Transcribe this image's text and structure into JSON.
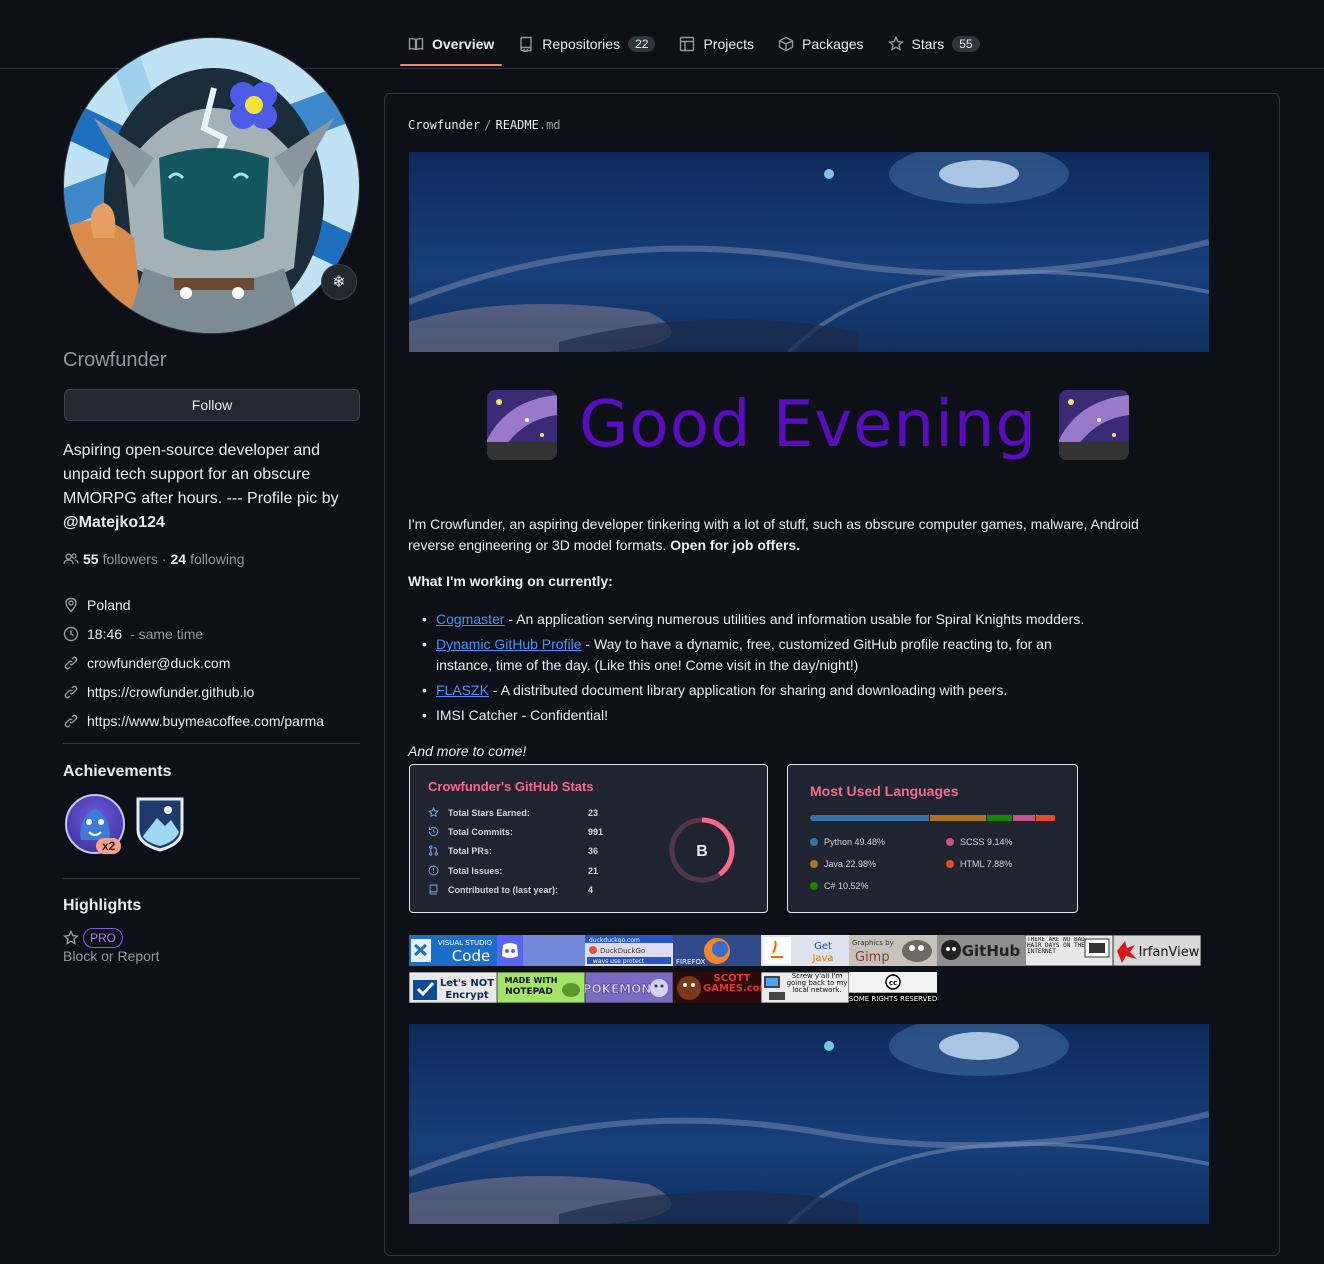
{
  "nav": {
    "tabs": [
      {
        "label": "Overview",
        "icon": "book-icon"
      },
      {
        "label": "Repositories",
        "count": "22",
        "icon": "repo-icon"
      },
      {
        "label": "Projects",
        "icon": "table-icon"
      },
      {
        "label": "Packages",
        "icon": "package-icon"
      },
      {
        "label": "Stars",
        "count": "55",
        "icon": "star-icon"
      }
    ]
  },
  "profile": {
    "status_emoji": "❄",
    "username": "Crowfunder",
    "follow_label": "Follow",
    "bio_text": "Aspiring open-source developer and unpaid tech support for an obscure MMORPG after hours. --- Profile pic by ",
    "bio_mention": "@Matejko124",
    "followers_count": "55",
    "followers_label": "followers",
    "following_sep": "·",
    "following_count": "24",
    "following_label": "following",
    "location": "Poland",
    "local_time": "18:46",
    "time_note": "- same time",
    "email": "crowfunder@duck.com",
    "website": "https://crowfunder.github.io",
    "link2": "https://www.buymeacoffee.com/parma"
  },
  "achievements": {
    "title": "Achievements",
    "multiplier": "x2"
  },
  "highlights": {
    "title": "Highlights",
    "pro_label": "PRO",
    "block_label": "Block or Report"
  },
  "readme": {
    "repo": "Crowfunder",
    "sep": "/",
    "file": "README",
    "ext": ".md",
    "greeting": "Good Evening",
    "intro_text": "I'm Crowfunder, an aspiring developer tinkering with a lot of stuff, such as obscure computer games, malware, Android reverse engineering or 3D model formats. ",
    "intro_bold": "Open for job offers.",
    "working_title": "What I'm working on currently:",
    "projects": [
      {
        "link": "Cogmaster",
        "text": " - An application serving numerous utilities and information usable for Spiral Knights modders."
      },
      {
        "link": "Dynamic GitHub Profile",
        "text": " - Way to have a dynamic, free, customized GitHub profile reacting to, for an instance, time of the day. (Like this one! Come visit in the day/night!)"
      },
      {
        "link": "FLASZK",
        "text": " - A distributed document library application for sharing and downloading with peers."
      },
      {
        "link": "",
        "text": "IMSI Catcher - Confidential!"
      }
    ],
    "more": "And more to come!"
  },
  "github_stats": {
    "title": "Crowfunder's GitHub Stats",
    "rows": [
      {
        "label": "Total Stars Earned:",
        "value": "23",
        "icon": "star-icon"
      },
      {
        "label": "Total Commits:",
        "value": "991",
        "icon": "history-icon"
      },
      {
        "label": "Total PRs:",
        "value": "36",
        "icon": "pull-request-icon"
      },
      {
        "label": "Total Issues:",
        "value": "21",
        "icon": "issue-icon"
      },
      {
        "label": "Contributed to (last year):",
        "value": "4",
        "icon": "repo-icon"
      }
    ],
    "rank": "B",
    "rank_progress": 0.4,
    "colors": {
      "title": "#f7688f",
      "ring": "#f7688f"
    }
  },
  "languages": {
    "title": "Most Used Languages",
    "items": [
      {
        "name": "Python",
        "pct": 49.48,
        "label": "Python 49.48%",
        "color": "#3572A5"
      },
      {
        "name": "Java",
        "pct": 22.98,
        "label": "Java 22.98%",
        "color": "#b07219"
      },
      {
        "name": "C#",
        "pct": 10.52,
        "label": "C# 10.52%",
        "color": "#178600"
      },
      {
        "name": "SCSS",
        "pct": 9.14,
        "label": "SCSS 9.14%",
        "color": "#c6538c"
      },
      {
        "name": "HTML",
        "pct": 7.88,
        "label": "HTML 7.88%",
        "color": "#e34c26"
      }
    ]
  },
  "web_buttons": {
    "vscode_top": "VISUAL STUDIO",
    "vscode_bottom": "Code",
    "duckduckgo_top": "duckduckgo.com",
    "duckduckgo_mid": "DuckDuckGo",
    "duckduckgo_bottom": "ways use protect",
    "firefox": "FIREFOX",
    "java_top": "Get",
    "java_bottom": "Java",
    "gimp_top": "Graphics by",
    "gimp_bottom": "Gimp",
    "github": "GitHub",
    "badhair": "THERE ARE NO BAD HAIR DAYS ON THE INTERNET",
    "irfanview": "IrfanView",
    "letsnot_top": "Let's NOT",
    "letsnot_bottom": "Encrypt",
    "notepad_top": "MADE WITH",
    "notepad_bottom": "NOTEPAD",
    "pokemon": "POKEMON",
    "scott": "SCOTT GAMES.com",
    "screw": "Screw y'all I'm going back to my local network.",
    "cc": "SOME RIGHTS RESERVED"
  }
}
